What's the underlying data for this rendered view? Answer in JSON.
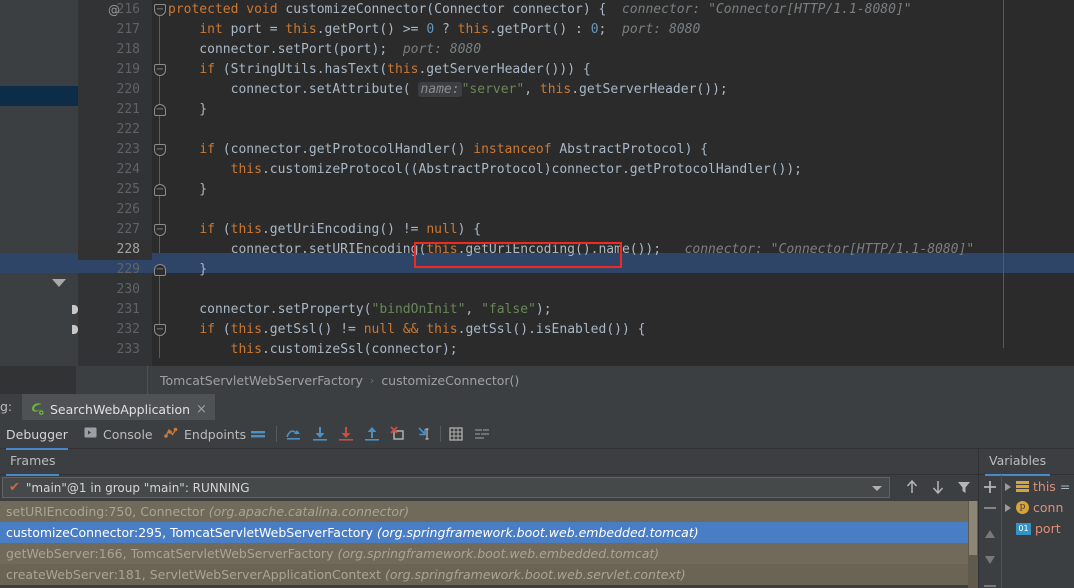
{
  "editor": {
    "lines": [
      {
        "num": "216",
        "anno": "@",
        "fold": "start",
        "indent": 0
      },
      {
        "num": "217",
        "anno": "",
        "fold": "",
        "indent": 0
      },
      {
        "num": "218",
        "anno": "",
        "fold": "",
        "indent": 0
      },
      {
        "num": "219",
        "anno": "",
        "fold": "start",
        "indent": 0
      },
      {
        "num": "220",
        "anno": "",
        "fold": "",
        "indent": 0
      },
      {
        "num": "221",
        "anno": "",
        "fold": "end",
        "indent": 0
      },
      {
        "num": "222",
        "anno": "",
        "fold": "",
        "indent": 0
      },
      {
        "num": "223",
        "anno": "",
        "fold": "start",
        "indent": 0
      },
      {
        "num": "224",
        "anno": "",
        "fold": "",
        "indent": 0
      },
      {
        "num": "225",
        "anno": "",
        "fold": "end",
        "indent": 0
      },
      {
        "num": "226",
        "anno": "",
        "fold": "",
        "indent": 0
      },
      {
        "num": "227",
        "anno": "",
        "fold": "start",
        "indent": 0
      },
      {
        "num": "228",
        "anno": "",
        "fold": "",
        "indent": 0
      },
      {
        "num": "229",
        "anno": "",
        "fold": "end",
        "indent": 0
      },
      {
        "num": "230",
        "anno": "",
        "fold": "",
        "indent": 0
      },
      {
        "num": "231",
        "anno": "",
        "fold": "",
        "indent": 0
      },
      {
        "num": "232",
        "anno": "",
        "fold": "start",
        "indent": 0
      },
      {
        "num": "233",
        "anno": "",
        "fold": "",
        "indent": 0
      }
    ],
    "current_line": "228",
    "code_text": [
      "protected void customizeConnector(Connector connector) {   connector: \"Connector[HTTP/1.1-8080]\"",
      "    int port = this.getPort() >= 0 ? this.getPort() : 0;  port: 8080",
      "    connector.setPort(port);  port: 8080",
      "    if (StringUtils.hasText(this.getServerHeader())) {",
      "        connector.setAttribute( name: \"server\", this.getServerHeader());",
      "    }",
      "",
      "    if (connector.getProtocolHandler() instanceof AbstractProtocol) {",
      "        this.customizeProtocol((AbstractProtocol)connector.getProtocolHandler());",
      "    }",
      "",
      "    if (this.getUriEncoding() != null) {",
      "        connector.setURIEncoding(this.getUriEncoding().name());   connector: \"Connector[HTTP/1.1-8080]\"",
      "    }",
      "",
      "    connector.setProperty(\"bindOnInit\", \"false\");",
      "    if (this.getSsl() != null && this.getSsl().isEnabled()) {",
      "        this.customizeSsl(connector);"
    ],
    "inlay_hints": {
      "line216": "connector: \"Connector[HTTP/1.1-8080]\"",
      "line217": "port: 8080",
      "line218": "port: 8080",
      "line220_param": "name:",
      "line228": "connector: \"Connector[HTTP/1.1-8080]\""
    },
    "highlight_color": "#2f4568",
    "red_box_color": "#ee2a22"
  },
  "breadcrumb": {
    "items": [
      "TomcatServletWebServerFactory",
      "customizeConnector()"
    ],
    "separator": "›"
  },
  "run_tab": {
    "prefix_label": "g:",
    "name": "SearchWebApplication",
    "close": "×"
  },
  "debug_toolbar": {
    "tabs": [
      {
        "label": "Debugger",
        "icon": "",
        "active": true
      },
      {
        "label": "Console",
        "icon": "console-icon",
        "active": false
      },
      {
        "label": "Endpoints",
        "icon": "endpoints-icon",
        "active": false
      }
    ],
    "buttons": [
      {
        "name": "show-execution-point-icon",
        "title": "Show Execution Point"
      },
      {
        "name": "step-over-icon",
        "title": "Step Over"
      },
      {
        "name": "step-into-icon",
        "title": "Step Into"
      },
      {
        "name": "force-step-into-icon",
        "title": "Force Step Into"
      },
      {
        "name": "step-out-icon",
        "title": "Step Out"
      },
      {
        "name": "drop-frame-icon",
        "title": "Drop Frame"
      },
      {
        "name": "run-to-cursor-icon",
        "title": "Run to Cursor"
      },
      {
        "name": "evaluate-expression-icon",
        "title": "Evaluate Expression"
      },
      {
        "name": "settings-layout-icon",
        "title": "Layout Settings"
      }
    ]
  },
  "frames": {
    "panel_title": "Frames",
    "thread": {
      "status_icon": "✔",
      "text": "\"main\"@1 in group \"main\": RUNNING"
    },
    "nav_buttons": [
      {
        "name": "frames-up-button",
        "glyph": "↑"
      },
      {
        "name": "frames-down-button",
        "glyph": "↓"
      },
      {
        "name": "frames-filter-button",
        "glyph": "filter-icon"
      }
    ],
    "rows": [
      {
        "method": "setURIEncoding:750, Connector",
        "pkg": "(org.apache.catalina.connector)",
        "selected": false
      },
      {
        "method": "customizeConnector:295, TomcatServletWebServerFactory",
        "pkg": "(org.springframework.boot.web.embedded.tomcat)",
        "selected": true
      },
      {
        "method": "getWebServer:166, TomcatServletWebServerFactory",
        "pkg": "(org.springframework.boot.web.embedded.tomcat)",
        "selected": false
      },
      {
        "method": "createWebServer:181, ServletWebServerApplicationContext",
        "pkg": "(org.springframework.boot.web.servlet.context)",
        "selected": false
      }
    ],
    "selected_color": "#4a7ec4"
  },
  "variables": {
    "panel_title": "Variables",
    "toolbar": [
      {
        "name": "add-watch-button",
        "glyph": "+"
      },
      {
        "name": "remove-watch-button",
        "glyph": "−"
      },
      {
        "name": "move-up-button",
        "glyph": "▲"
      },
      {
        "name": "move-down-button",
        "glyph": "▼"
      }
    ],
    "rows": [
      {
        "name": "this",
        "suffix": "=",
        "icon": "field-group-icon",
        "expandable": true
      },
      {
        "name": "conn",
        "suffix": "",
        "icon": "parameter-icon",
        "expandable": true
      },
      {
        "name": "port",
        "suffix": "",
        "icon": "primitive-icon",
        "expandable": false
      }
    ]
  }
}
